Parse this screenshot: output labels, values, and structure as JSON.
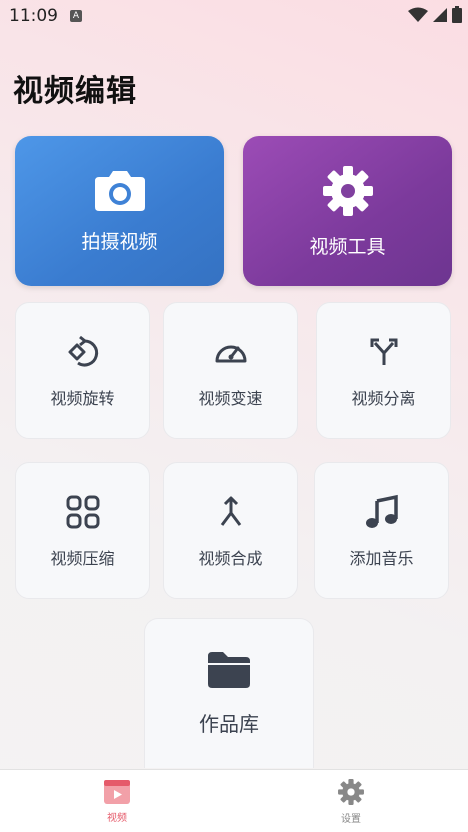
{
  "status": {
    "time": "11:09",
    "notification_badge": "A"
  },
  "page": {
    "title": "视频编辑"
  },
  "cards": {
    "record": {
      "label": "拍摄视频",
      "icon": "camera-icon",
      "color": "#4a8be0"
    },
    "tools": {
      "label": "视频工具",
      "icon": "gear-icon",
      "color": "#8a3fab"
    }
  },
  "tiles": [
    {
      "label": "视频旋转",
      "icon": "rotate-icon"
    },
    {
      "label": "视频变速",
      "icon": "speedometer-icon"
    },
    {
      "label": "视频分离",
      "icon": "split-icon"
    },
    {
      "label": "视频压缩",
      "icon": "grid-icon"
    },
    {
      "label": "视频合成",
      "icon": "merge-icon"
    },
    {
      "label": "添加音乐",
      "icon": "music-note-icon"
    }
  ],
  "library": {
    "label": "作品库",
    "icon": "folder-icon"
  },
  "nav": {
    "items": [
      {
        "label": "视频",
        "icon": "video-icon",
        "active": true,
        "color": "#e55a6a"
      },
      {
        "label": "设置",
        "icon": "gear-icon",
        "active": false,
        "color": "#888888"
      }
    ]
  }
}
